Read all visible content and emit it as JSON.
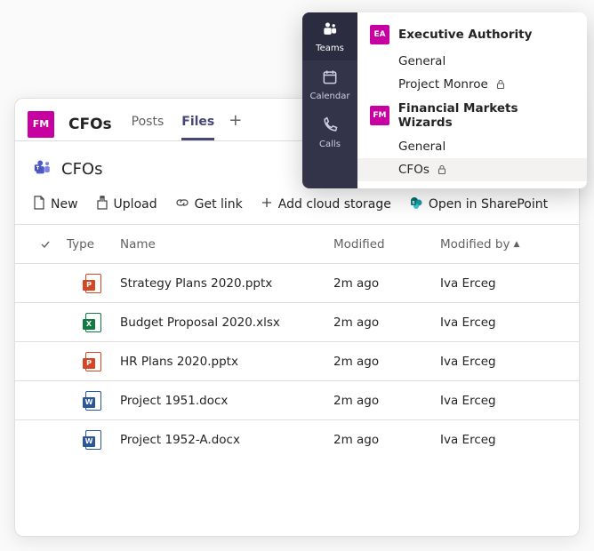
{
  "colors": {
    "accent": "#c600a1",
    "rail": "#33344a",
    "sharepoint": "#036c70",
    "powerpoint": "#d24726",
    "excel": "#107c41",
    "word": "#2b579a"
  },
  "popover": {
    "rail": [
      {
        "label": "Teams",
        "icon": "teams-icon",
        "active": true
      },
      {
        "label": "Calendar",
        "icon": "calendar-icon",
        "active": false
      },
      {
        "label": "Calls",
        "icon": "calls-icon",
        "active": false
      }
    ],
    "teams": [
      {
        "abbrev": "EA",
        "color": "#c600a1",
        "name": "Executive Authority",
        "channels": [
          {
            "name": "General",
            "private": false,
            "selected": false
          },
          {
            "name": "Project Monroe",
            "private": true,
            "selected": false
          }
        ]
      },
      {
        "abbrev": "FM",
        "color": "#c600a1",
        "name": "Financial Markets Wizards",
        "channels": [
          {
            "name": "General",
            "private": false,
            "selected": false
          },
          {
            "name": "CFOs",
            "private": true,
            "selected": true
          }
        ]
      }
    ]
  },
  "header": {
    "team_abbrev": "FM",
    "channel": "CFOs",
    "tabs": [
      {
        "label": "Posts",
        "active": false
      },
      {
        "label": "Files",
        "active": true
      }
    ],
    "add_tab_glyph": "+"
  },
  "title": {
    "label": "CFOs"
  },
  "toolbar": {
    "new": "New",
    "upload": "Upload",
    "get_link": "Get link",
    "add_cloud": "Add cloud storage",
    "open_sp": "Open in SharePoint"
  },
  "columns": {
    "type": "Type",
    "name": "Name",
    "modified": "Modified",
    "modified_by": "Modified by",
    "sort_dir_glyph": "▲"
  },
  "files": [
    {
      "kind": "pptx",
      "letter": "P",
      "name": "Strategy Plans 2020.pptx",
      "modified": "2m ago",
      "modified_by": "Iva Erceg"
    },
    {
      "kind": "xlsx",
      "letter": "X",
      "name": "Budget Proposal 2020.xlsx",
      "modified": "2m ago",
      "modified_by": "Iva Erceg"
    },
    {
      "kind": "pptx",
      "letter": "P",
      "name": "HR Plans 2020.pptx",
      "modified": "2m ago",
      "modified_by": "Iva Erceg"
    },
    {
      "kind": "docx",
      "letter": "W",
      "name": "Project 1951.docx",
      "modified": "2m ago",
      "modified_by": "Iva Erceg"
    },
    {
      "kind": "docx",
      "letter": "W",
      "name": "Project 1952-A.docx",
      "modified": "2m ago",
      "modified_by": "Iva Erceg"
    }
  ]
}
